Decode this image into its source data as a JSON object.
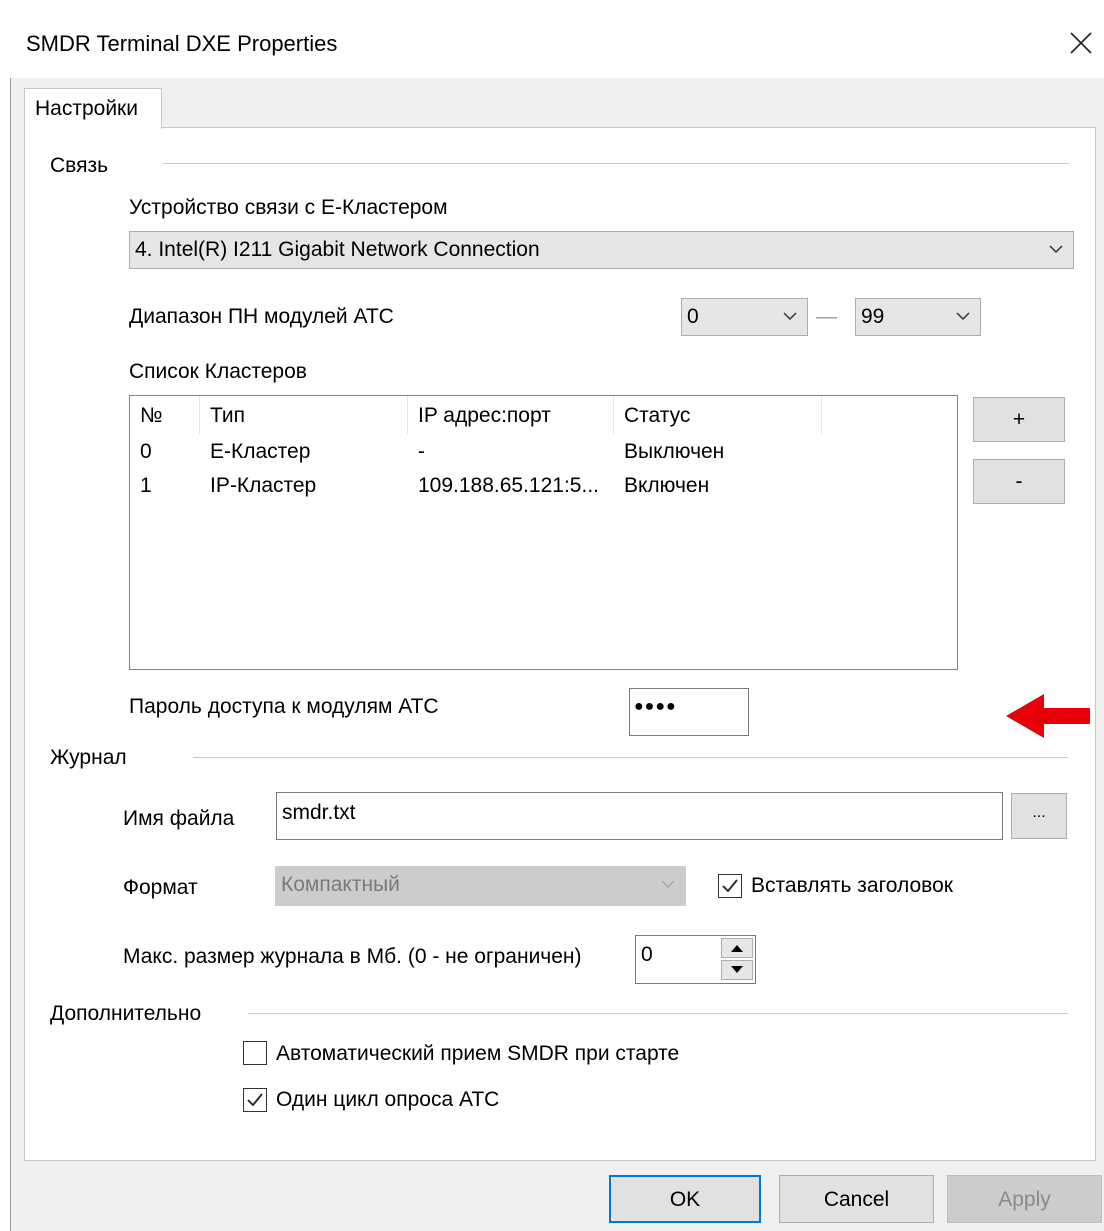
{
  "window": {
    "title": "SMDR Terminal DXE Properties",
    "close_glyph": "✕"
  },
  "tab": {
    "label": "Настройки"
  },
  "connection": {
    "heading": "Связь",
    "device_label": "Устройство связи с Е-Кластером",
    "device_value": "4. Intel(R) I211 Gigabit Network Connection",
    "range_label": "Диапазон ПН модулей АТС",
    "range_from": "0",
    "range_dash": "—",
    "range_to": "99",
    "cluster_list_label": "Список Кластеров",
    "columns": [
      "№",
      "Тип",
      "IP адрес:порт",
      "Статус"
    ],
    "rows": [
      [
        "0",
        "Е-Кластер",
        "-",
        "Выключен"
      ],
      [
        "1",
        "IP-Кластер",
        "109.188.65.121:5...",
        "Включен"
      ]
    ],
    "add_button": "+",
    "remove_button": "-",
    "password_label": "Пароль доступа к модулям АТС",
    "password_value": "●●●●"
  },
  "journal": {
    "heading": "Журнал",
    "filename_label": "Имя файла",
    "filename_value": "smdr.txt",
    "browse_button": "...",
    "format_label": "Формат",
    "format_value": "Компактный",
    "insert_header_label": "Вставлять заголовок",
    "insert_header_checked": true,
    "maxsize_label": "Макс. размер журнала в Мб. (0 - не ограничен)",
    "maxsize_value": "0"
  },
  "additional": {
    "heading": "Дополнительно",
    "auto_receive_label": "Автоматический прием SMDR при старте",
    "auto_receive_checked": false,
    "one_cycle_label": "Один цикл опроса АТС",
    "one_cycle_checked": true
  },
  "footer": {
    "ok": "OK",
    "cancel": "Cancel",
    "apply": "Apply"
  },
  "colors": {
    "arrow": "#e8000b",
    "accent_border": "#0078d7"
  }
}
